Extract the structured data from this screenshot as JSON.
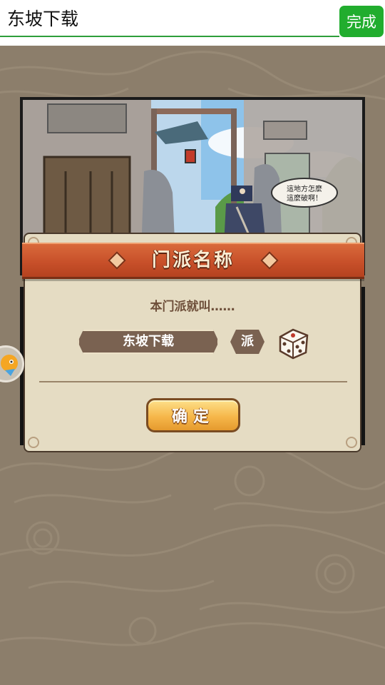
{
  "input": {
    "value": "东坡下载",
    "done_label": "完成"
  },
  "comic": {
    "speech": [
      "這地方怎麼",
      "這麼破啊！"
    ]
  },
  "dialog": {
    "title": "门派名称",
    "subtitle": "本门派就叫……",
    "sect_name": "东坡下载",
    "suffix": "派",
    "confirm_label": "确定"
  },
  "icons": {
    "dice": "dice-icon",
    "floating": "mascot-icon"
  },
  "colors": {
    "input_underline": "#2e9e3a",
    "done_button": "#21ad2e",
    "banner": "#c8502a",
    "dialog_bg": "#e5dcc3",
    "confirm_button": "#f6b74a"
  }
}
